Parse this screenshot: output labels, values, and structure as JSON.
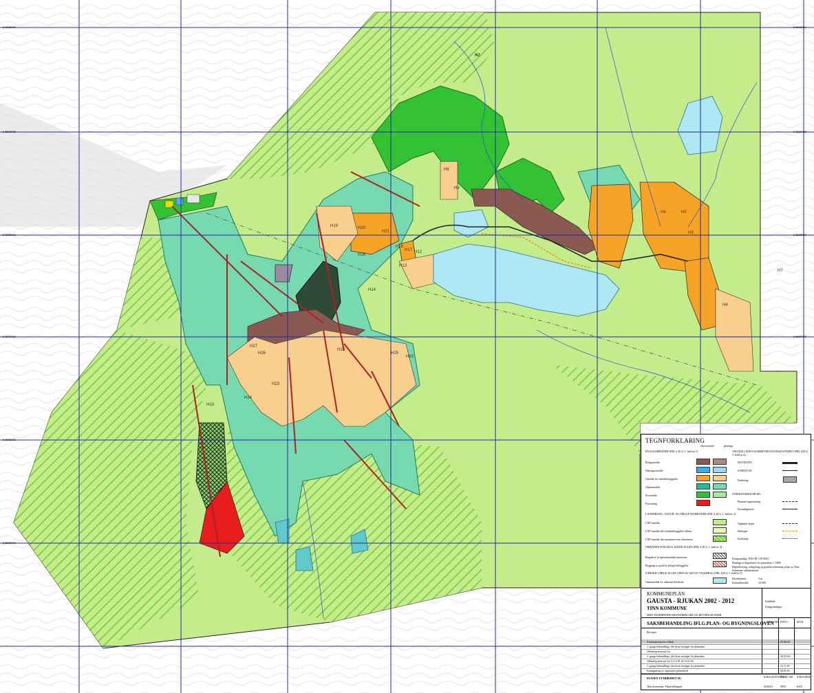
{
  "map": {
    "grid_labels": {
      "right": [
        "6 6615000",
        "6 6610000",
        "6 6605000",
        "6 6600000",
        "6 6595000",
        "6 6590000"
      ],
      "left": [
        "6 6615000",
        "6 6610000",
        "6 6605000",
        "6 6600000",
        "6 6595000",
        "6 6590000"
      ]
    },
    "zone_labels": [
      "H20",
      "H19",
      "H21",
      "H18",
      "H16",
      "H17",
      "H13",
      "H12",
      "H14",
      "H15",
      "H22",
      "H23",
      "H24",
      "H25",
      "H26",
      "H27",
      "H8",
      "H2",
      "H7",
      "H4",
      "H3",
      "H5",
      "H6",
      "H9",
      "H10",
      "A2"
    ],
    "colors": {
      "lnf_green": "#c5ec8b",
      "hatch_green": "#6fc93d",
      "forest_green": "#33c233",
      "turquoise": "#77d9b0",
      "dark_forest": "#2f4a35",
      "brown": "#8a5a52",
      "orange": "#f7a326",
      "tan": "#f8cf8d",
      "light_blue": "#aee8f5",
      "red": "#e81e1e",
      "grid_blue": "#1f2aa8"
    }
  },
  "legend": {
    "title": "TEGNFORKLARING",
    "col_headers": [
      "eksisterende",
      "planlagt"
    ],
    "build_header": "BYGGEOMRÅDER (PBL § 20-4, 1. ledd nr 1)",
    "build_items": [
      "Boligområde",
      "Næringsområde",
      "Område for fritidsbebyggelse",
      "Alpinområde",
      "Friområde",
      "Forretning"
    ],
    "road_header": "VIKTIGE LEDD I KOMMUNIKASJONSSYSTEMET (PBL §20-4, 1. ledd nr 4)",
    "road_items": [
      "HOVEDVEI",
      "SAMLEVEI",
      "Parkering"
    ],
    "line_header": "STREKSYMBOLER MV",
    "line_items": [
      "Planens begrensning",
      "Formålsgrense",
      "Oppkjørt løype",
      "Skiløype",
      "Kraftlinje"
    ],
    "lnf_header": "LANDBRUKS-, NATUR- OG FRILUFTSOMRÅDER (PBL § 20-4, 1. ledd nr 2)",
    "lnf_items": [
      "LNF-område",
      "LNF-område der fritidsbebyggelse tillates",
      "LNF-område der naturinteresser dominerer"
    ],
    "special_header": "OMRÅDER SOM SKAL BÅNDLEGGES (PBL § 20-4, 1. ledd nr 4)",
    "special_items": [
      "Regulerte til spesialområde naturvern",
      "Bygging av gradvis utbygd bebyggelse"
    ],
    "water_header": "SÆRSKILT BRUK ELLER VERN AV SJØ OG VASSDRAG (PBL §20-4, 1. ledd nr 5)",
    "water_items": [
      "Vannområde for allmenn friluftsliv"
    ],
    "notes": [
      "Kartgrunnlag: N50 (M 1:50 000)",
      "Planlagt er digitalisert fra masterkart 1:5000",
      "Digitalisering, redigering og grafisk utforming utført av Tinn kommune, plankontoret"
    ],
    "equidistance_label": "Ekvidistanse",
    "equidistance_value": "5 m",
    "scale_label": "Kartmålestokk",
    "scale_value": "10 000"
  },
  "title_block": {
    "plan_type": "KOMMUNEPLAN",
    "plan_name": "GAUSTA - RJUKAN 2002 - 2012",
    "municipality": "TINN KOMMUNE",
    "subtitle": "MED TILHØRENDE BESTEMMELSER OG RETNINGSLINJER",
    "map_info_1": "Kartblad:",
    "map_info_2": "Kartgrunnlaget:",
    "procedure_title": "SAKSBEHANDLING IFLG.PLAN- OG BYGNINGSLOVEN",
    "col_sak": "SAKS NR",
    "col_dato": "DATO",
    "col_sign": "SIGN.",
    "revision_label": "Revisjon",
    "rows": [
      {
        "text": "Kommunestyrets vedtak",
        "date": "05.06.02"
      },
      {
        "text": "1. gangs behandling i det faste utvalget for plansaker",
        "date": ""
      },
      {
        "text": "Offentlig ettersyn fra",
        "date": ""
      },
      {
        "text": "2. gangs behandling i det faste utvalget for plansaker",
        "date": "20.02.02"
      },
      {
        "text": "Offentlig ettersyn fra 12.12.01 til 12.01.02",
        "date": ""
      },
      {
        "text": "1. gangs behandling i det faste utvalget for plansaker",
        "date": "13.11.01"
      },
      {
        "text": "Kunngjøring av oppstartet planarbeid",
        "date": "04.01.01"
      }
    ],
    "prepared_label": "PLANEN UTARBEIDET AV:",
    "prepared_by": "Tinn kommune, Planavdelingen",
    "footer_cols": [
      "SAKS KONTROLL",
      "TEGN. NR",
      "SAKS BEH."
    ],
    "footer_vals": [
      "02/0021",
      "5933",
      "KSA"
    ]
  }
}
